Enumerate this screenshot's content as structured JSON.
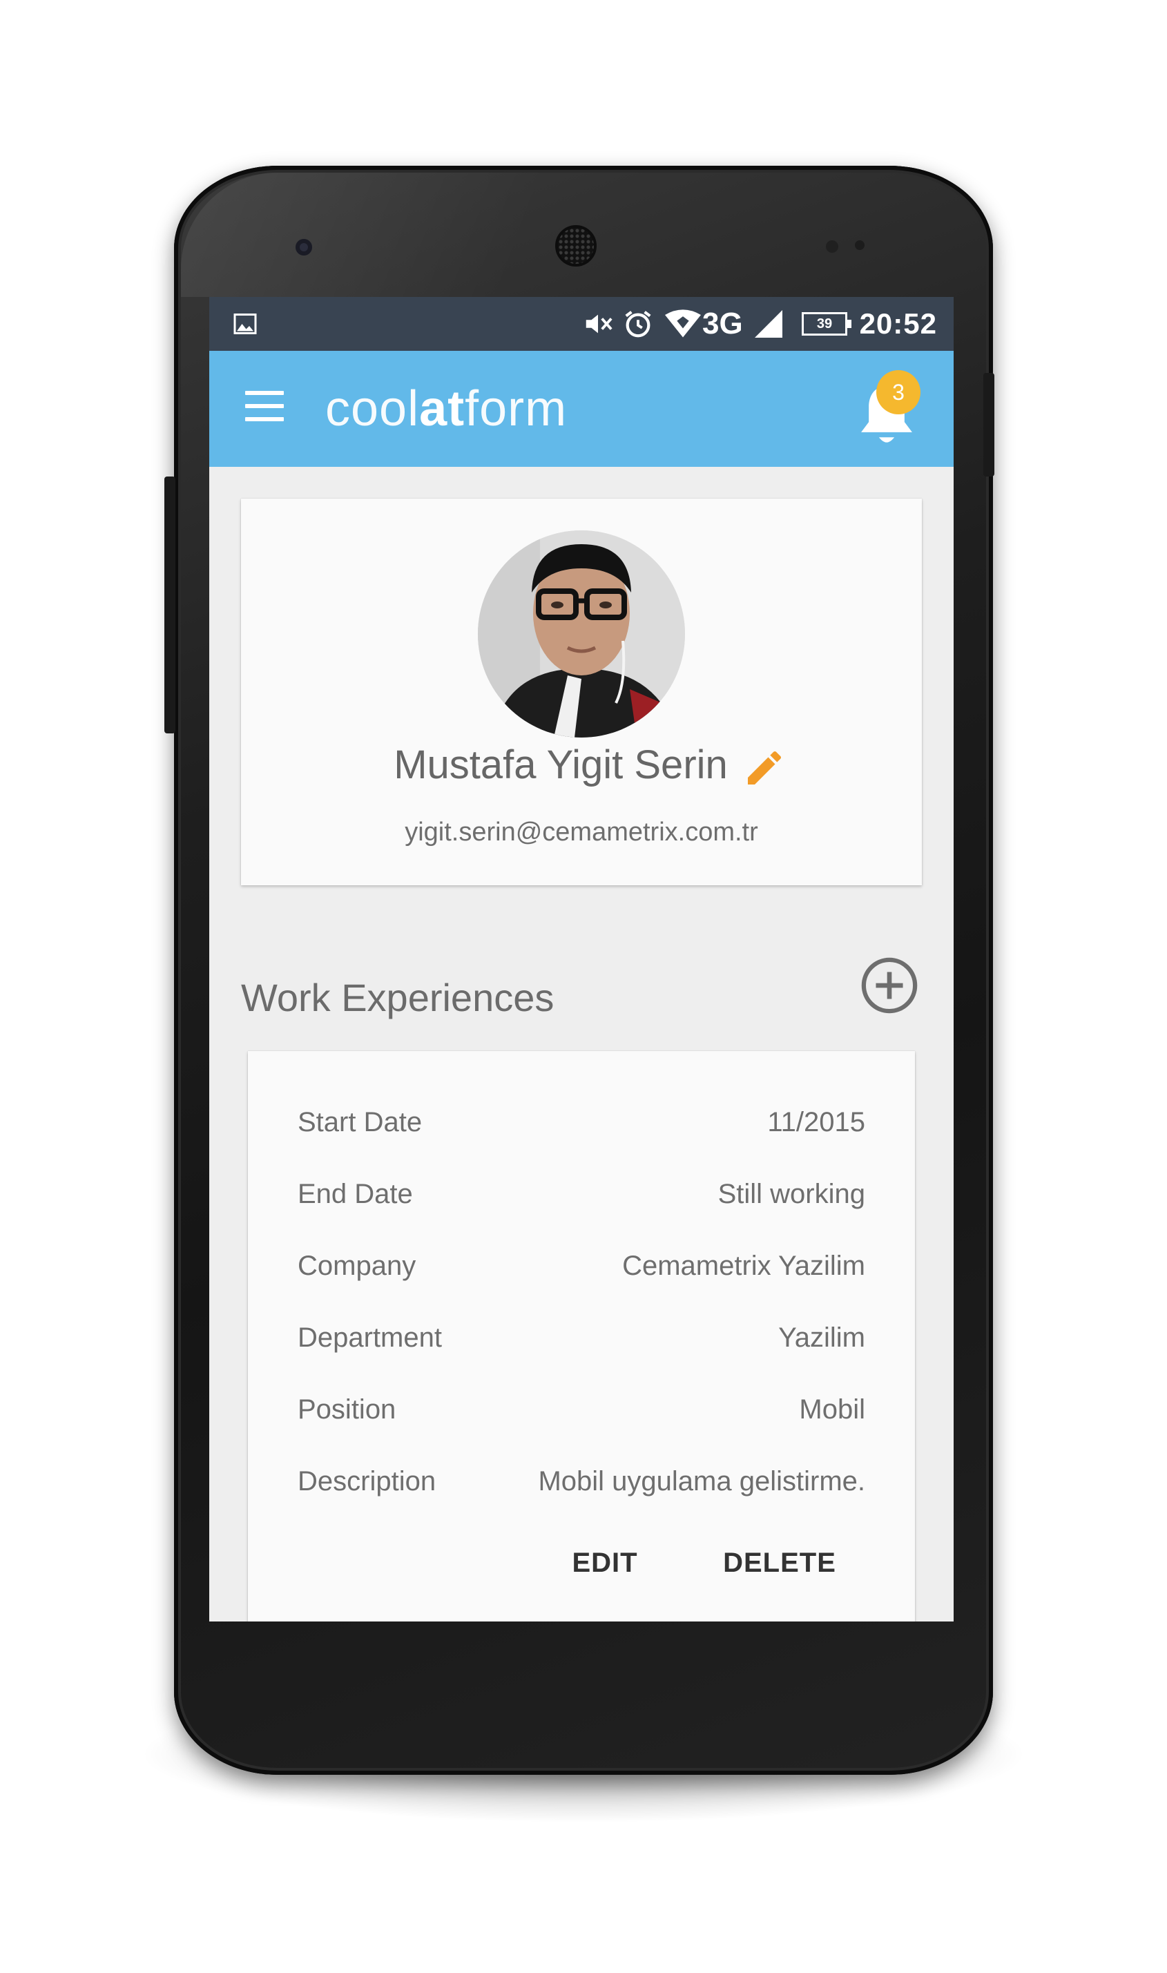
{
  "status_bar": {
    "time": "20:52",
    "network": "3G",
    "battery": "39",
    "icons": [
      "image-icon",
      "vibrate-off-icon",
      "alarm-icon",
      "wifi-icon",
      "signal-icon",
      "battery-icon"
    ]
  },
  "app_bar": {
    "brand_part1": "cool",
    "brand_part2": "at",
    "brand_part3": "form",
    "notification_count": "3",
    "color": "#62b9e9"
  },
  "profile": {
    "name": "Mustafa Yigit Serin",
    "email": "yigit.serin@cemametrix.com.tr"
  },
  "work_section": {
    "title": "Work Experiences",
    "rows": [
      {
        "label": "Start Date",
        "value": "11/2015"
      },
      {
        "label": "End Date",
        "value": "Still working"
      },
      {
        "label": "Company",
        "value": "Cemametrix Yazilim"
      },
      {
        "label": "Department",
        "value": "Yazilim"
      },
      {
        "label": "Position",
        "value": "Mobil"
      },
      {
        "label": "Description",
        "value": "Mobil uygulama gelistirme."
      }
    ],
    "edit_label": "EDIT",
    "delete_label": "DELETE"
  },
  "colors": {
    "accent": "#f29b27",
    "badge": "#f5b82e",
    "status_bar": "#394452"
  }
}
